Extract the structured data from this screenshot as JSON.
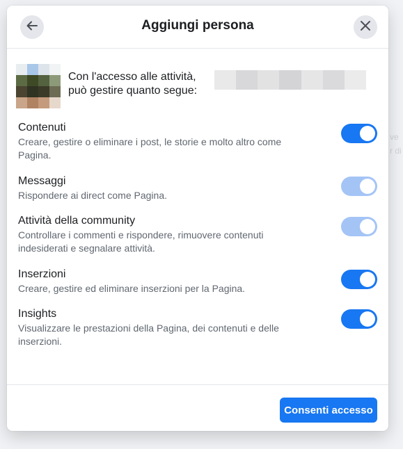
{
  "dialog": {
    "title": "Aggiungi persona",
    "access_line1": "Con l'accesso alle attività,",
    "access_line2": "può gestire quanto segue:"
  },
  "permissions": [
    {
      "title": "Contenuti",
      "description": "Creare, gestire o eliminare i post, le storie e molto altro come Pagina.",
      "enabled": true,
      "locked": false
    },
    {
      "title": "Messaggi",
      "description": "Rispondere ai direct come Pagina.",
      "enabled": true,
      "locked": true
    },
    {
      "title": "Attività della community",
      "description": "Controllare i commenti e rispondere, rimuovere contenuti indesiderati e segnalare attività.",
      "enabled": true,
      "locked": true
    },
    {
      "title": "Inserzioni",
      "description": "Creare, gestire ed eliminare inserzioni per la Pagina.",
      "enabled": true,
      "locked": false
    },
    {
      "title": "Insights",
      "description": "Visualizzare le prestazioni della Pagina, dei contenuti e delle inserzioni.",
      "enabled": true,
      "locked": false
    }
  ],
  "footer": {
    "primary_label": "Consenti accesso"
  },
  "icons": {
    "back": "arrow-left-icon",
    "close": "close-icon"
  },
  "colors": {
    "accent": "#1877f2",
    "toggle_disabled": "#a4c4f6",
    "text_primary": "#1c1e21",
    "text_secondary": "#606770"
  }
}
